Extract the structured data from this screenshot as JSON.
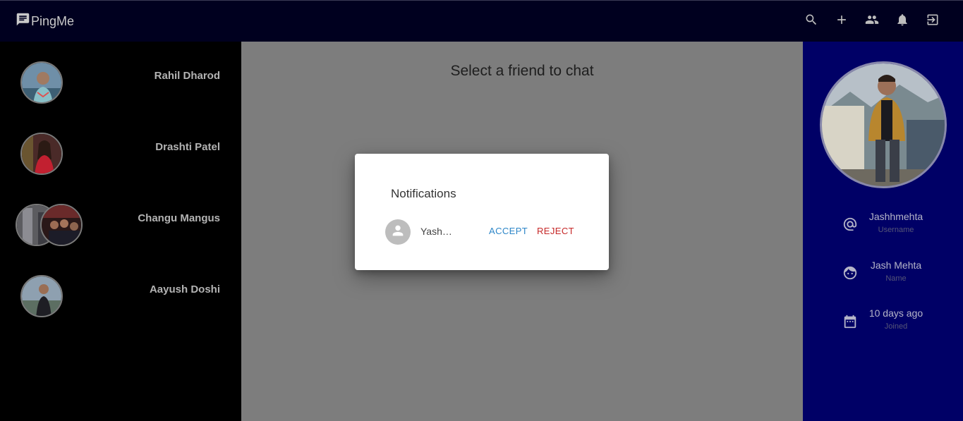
{
  "app": {
    "title": "PingMe"
  },
  "toolbar": {
    "icons": [
      "search-icon",
      "add-icon",
      "group-icon",
      "notifications-icon",
      "logout-icon"
    ]
  },
  "friends": [
    {
      "name": "Rahil Dharod"
    },
    {
      "name": "Drashti Patel"
    },
    {
      "name": "Changu Mangus"
    },
    {
      "name": "Aayush Doshi"
    }
  ],
  "chat": {
    "prompt": "Select a friend to chat"
  },
  "profile": {
    "username": "Jashhmehta",
    "username_label": "Username",
    "name": "Jash Mehta",
    "name_label": "Name",
    "joined": "10 days ago",
    "joined_label": "Joined"
  },
  "dialog": {
    "title": "Notifications",
    "requests": [
      {
        "name": "Yash…"
      }
    ],
    "accept_label": "ACCEPT",
    "reject_label": "REJECT"
  },
  "colors": {
    "appbar": "#00001f",
    "profile_panel": "#000066",
    "accept": "#2d86c8",
    "reject": "#c62828"
  }
}
